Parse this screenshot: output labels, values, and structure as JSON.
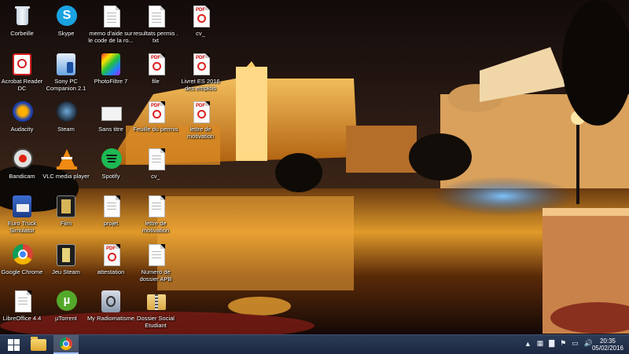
{
  "desktop": {
    "icons": [
      {
        "label": "Corbeille",
        "icon": "recycle-bin-icon"
      },
      {
        "label": "Skype",
        "icon": "skype-icon"
      },
      {
        "label": "memo d'aide sur le code de la ro...",
        "icon": "text-file-icon"
      },
      {
        "label": "resultats permis . txt",
        "icon": "text-file-icon"
      },
      {
        "label": "cv_",
        "icon": "pdf-file-icon"
      },
      {
        "label": "Acrobat Reader DC",
        "icon": "acrobat-reader-icon"
      },
      {
        "label": "Sony PC Companion 2.1",
        "icon": "sony-pc-companion-icon"
      },
      {
        "label": "PhotoFiltre 7",
        "icon": "photofiltre-icon"
      },
      {
        "label": "file",
        "icon": "pdf-file-icon"
      },
      {
        "label": "Livret ES 2016 des emplois saison...",
        "icon": "pdf-file-icon"
      },
      {
        "label": "Audacity",
        "icon": "audacity-icon"
      },
      {
        "label": "Steam",
        "icon": "steam-icon"
      },
      {
        "label": "Sans titre",
        "icon": "blank-file-icon"
      },
      {
        "label": "Feuille du permis",
        "icon": "pdf-file-icon"
      },
      {
        "label": "lettre de motivation",
        "icon": "pdf-file-icon"
      },
      {
        "label": "Bandicam",
        "icon": "bandicam-icon"
      },
      {
        "label": "VLC media player",
        "icon": "vlc-icon"
      },
      {
        "label": "Spotify",
        "icon": "spotify-icon"
      },
      {
        "label": "cv_",
        "icon": "document-file-icon"
      },
      {
        "label": "Euro Truck Simulator",
        "icon": "euro-truck-simulator-icon"
      },
      {
        "label": "Film",
        "icon": "film-shortcut-icon"
      },
      {
        "label": "projet",
        "icon": "document-file-icon"
      },
      {
        "label": "lettre de motivation",
        "icon": "document-file-icon"
      },
      {
        "label": "Google Chrome",
        "icon": "google-chrome-icon"
      },
      {
        "label": "Jeu Steam",
        "icon": "steam-game-shortcut-icon"
      },
      {
        "label": "attestation",
        "icon": "pdf-file-icon"
      },
      {
        "label": "Numero de dossier APB",
        "icon": "text-file-icon"
      },
      {
        "label": "LibreOffice 4.4",
        "icon": "libreoffice-icon"
      },
      {
        "label": "µTorrent",
        "icon": "utorrent-icon"
      },
      {
        "label": "My Radiomatisme",
        "icon": "radiomatisme-icon"
      },
      {
        "label": "Dossier Social Etudiant",
        "icon": "folder-zip-icon"
      }
    ]
  },
  "colors": {
    "taskbar": "#1c2841",
    "acrobat_red": "#d22020",
    "skype_blue": "#1aa3e0",
    "spotify_green": "#1db954"
  },
  "taskbar": {
    "pinned": [
      {
        "icon": "windows-start-icon"
      },
      {
        "icon": "file-explorer-icon"
      },
      {
        "icon": "google-chrome-icon"
      }
    ],
    "tray_icons": [
      "chevron-up-icon",
      "network-icon",
      "signal-icon",
      "flag-icon",
      "battery-icon",
      "volume-icon"
    ],
    "clock_time": "20:35",
    "clock_date": "05/02/2016"
  }
}
